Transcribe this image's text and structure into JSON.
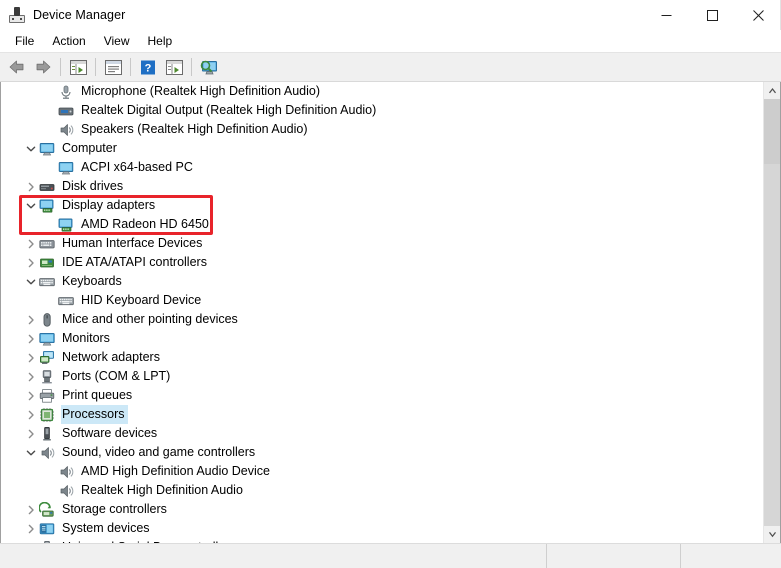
{
  "window": {
    "title": "Device Manager",
    "icon": "device-manager-icon",
    "controls": {
      "minimize": "minimize",
      "maximize": "maximize",
      "close": "close"
    }
  },
  "menubar": {
    "items": [
      {
        "label": "File",
        "name": "menu-file"
      },
      {
        "label": "Action",
        "name": "menu-action"
      },
      {
        "label": "View",
        "name": "menu-view"
      },
      {
        "label": "Help",
        "name": "menu-help"
      }
    ]
  },
  "toolbar": {
    "buttons": [
      {
        "name": "back-button",
        "icon": "back-arrow-icon",
        "enabled": false
      },
      {
        "name": "forward-button",
        "icon": "forward-arrow-icon",
        "enabled": false
      },
      {
        "name": "show-hide-console-tree-button",
        "icon": "console-tree-icon",
        "enabled": true
      },
      {
        "name": "properties-button",
        "icon": "properties-icon",
        "enabled": true
      },
      {
        "name": "help-button",
        "icon": "help-question-icon",
        "enabled": true
      },
      {
        "name": "update-driver-button",
        "icon": "update-driver-icon",
        "enabled": true
      },
      {
        "name": "scan-for-hardware-changes-button",
        "icon": "scan-hardware-icon",
        "enabled": true
      }
    ]
  },
  "tree": {
    "rows": [
      {
        "label": "Microphone (Realtek High Definition Audio)",
        "level": 2,
        "expander": "none",
        "icon": "microphone-icon",
        "name": "tree-item-microphone",
        "selected": false
      },
      {
        "label": "Realtek Digital Output (Realtek High Definition Audio)",
        "level": 2,
        "expander": "none",
        "icon": "digital-output-icon",
        "name": "tree-item-realtek-digital-output",
        "selected": false
      },
      {
        "label": "Speakers (Realtek High Definition Audio)",
        "level": 2,
        "expander": "none",
        "icon": "speaker-icon",
        "name": "tree-item-speakers",
        "selected": false
      },
      {
        "label": "Computer",
        "level": 1,
        "expander": "expanded",
        "icon": "computer-icon",
        "name": "tree-item-computer",
        "selected": false
      },
      {
        "label": "ACPI x64-based PC",
        "level": 2,
        "expander": "none",
        "icon": "computer-icon",
        "name": "tree-item-acpi-x64-based-pc",
        "selected": false
      },
      {
        "label": "Disk drives",
        "level": 1,
        "expander": "collapsed",
        "icon": "disk-drive-icon",
        "name": "tree-item-disk-drives",
        "selected": false
      },
      {
        "label": "Display adapters",
        "level": 1,
        "expander": "expanded",
        "icon": "display-adapter-icon",
        "name": "tree-item-display-adapters",
        "selected": false
      },
      {
        "label": "AMD Radeon HD 6450",
        "level": 2,
        "expander": "none",
        "icon": "display-adapter-icon",
        "name": "tree-item-amd-radeon-hd-6450",
        "selected": false
      },
      {
        "label": "Human Interface Devices",
        "level": 1,
        "expander": "collapsed",
        "icon": "hid-icon",
        "name": "tree-item-human-interface-devices",
        "selected": false
      },
      {
        "label": "IDE ATA/ATAPI controllers",
        "level": 1,
        "expander": "collapsed",
        "icon": "ide-controller-icon",
        "name": "tree-item-ide-ata-atapi-controllers",
        "selected": false
      },
      {
        "label": "Keyboards",
        "level": 1,
        "expander": "expanded",
        "icon": "keyboard-icon",
        "name": "tree-item-keyboards",
        "selected": false
      },
      {
        "label": "HID Keyboard Device",
        "level": 2,
        "expander": "none",
        "icon": "keyboard-icon",
        "name": "tree-item-hid-keyboard-device",
        "selected": false
      },
      {
        "label": "Mice and other pointing devices",
        "level": 1,
        "expander": "collapsed",
        "icon": "mouse-icon",
        "name": "tree-item-mice-and-other-pointing-devices",
        "selected": false
      },
      {
        "label": "Monitors",
        "level": 1,
        "expander": "collapsed",
        "icon": "monitor-icon",
        "name": "tree-item-monitors",
        "selected": false
      },
      {
        "label": "Network adapters",
        "level": 1,
        "expander": "collapsed",
        "icon": "network-adapter-icon",
        "name": "tree-item-network-adapters",
        "selected": false
      },
      {
        "label": "Ports (COM & LPT)",
        "level": 1,
        "expander": "collapsed",
        "icon": "port-icon",
        "name": "tree-item-ports-com-lpt",
        "selected": false
      },
      {
        "label": "Print queues",
        "level": 1,
        "expander": "collapsed",
        "icon": "printer-icon",
        "name": "tree-item-print-queues",
        "selected": false
      },
      {
        "label": "Processors",
        "level": 1,
        "expander": "collapsed",
        "icon": "processor-icon",
        "name": "tree-item-processors",
        "selected": true
      },
      {
        "label": "Software devices",
        "level": 1,
        "expander": "collapsed",
        "icon": "software-device-icon",
        "name": "tree-item-software-devices",
        "selected": false
      },
      {
        "label": "Sound, video and game controllers",
        "level": 1,
        "expander": "expanded",
        "icon": "speaker-icon",
        "name": "tree-item-sound-video-and-game-controllers",
        "selected": false
      },
      {
        "label": "AMD High Definition Audio Device",
        "level": 2,
        "expander": "none",
        "icon": "speaker-icon",
        "name": "tree-item-amd-high-definition-audio-device",
        "selected": false
      },
      {
        "label": "Realtek High Definition Audio",
        "level": 2,
        "expander": "none",
        "icon": "speaker-icon",
        "name": "tree-item-realtek-high-definition-audio",
        "selected": false
      },
      {
        "label": "Storage controllers",
        "level": 1,
        "expander": "collapsed",
        "icon": "storage-controller-icon",
        "name": "tree-item-storage-controllers",
        "selected": false
      },
      {
        "label": "System devices",
        "level": 1,
        "expander": "collapsed",
        "icon": "system-device-icon",
        "name": "tree-item-system-devices",
        "selected": false
      },
      {
        "label": "Universal Serial Bus controllers",
        "level": 1,
        "expander": "collapsed",
        "icon": "usb-controller-icon",
        "name": "tree-item-universal-serial-bus-controllers",
        "selected": false
      }
    ]
  },
  "annotation": {
    "name": "red-highlight-box",
    "color": "#e8232a",
    "targets": [
      "Display adapters",
      "AMD Radeon HD 6450"
    ]
  },
  "scrollbar": {
    "name": "vertical-scrollbar",
    "up_arrow": "scroll-up-icon",
    "down_arrow": "scroll-down-icon",
    "thumb_color": "#cdcdcd"
  },
  "statusbar": {
    "panes": [
      "",
      "",
      ""
    ]
  },
  "colors": {
    "selection": "#cce8f7",
    "annotation": "#e8232a",
    "toolbar_bg": "#f0f0f0",
    "statusbar_bg": "#f0f0f0"
  }
}
